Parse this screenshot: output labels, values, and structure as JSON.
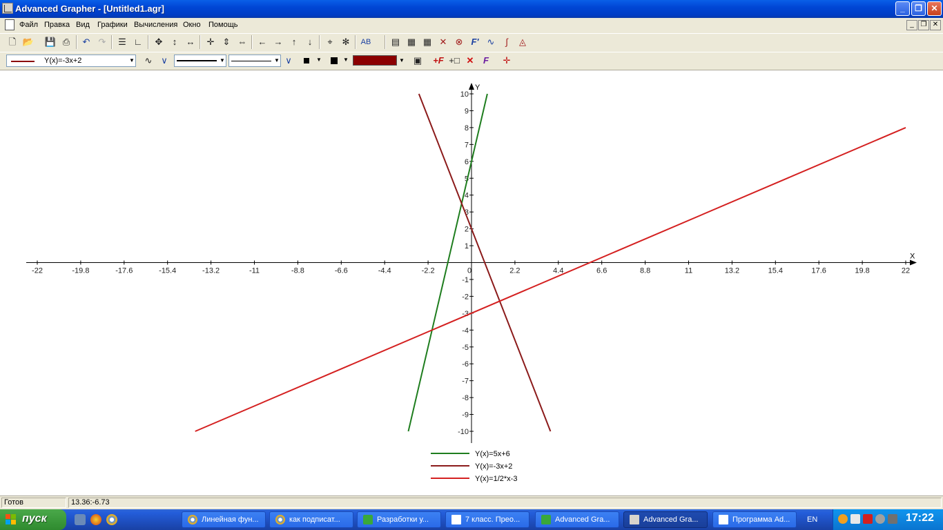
{
  "window": {
    "title": "Advanced Grapher - [Untitled1.agr]",
    "controls": {
      "minimize": "_",
      "maximize": "❐",
      "close": "✕"
    }
  },
  "menu": {
    "items": [
      "Файл",
      "Правка",
      "Вид",
      "Графики",
      "Вычисления",
      "Окно",
      "Помощь"
    ],
    "mdi": {
      "minimize": "_",
      "restore": "❐",
      "close": "✕"
    }
  },
  "toolbar2": {
    "function_select": "Y(x)=-3x+2",
    "color": "#8b0000"
  },
  "chart_data": {
    "type": "line",
    "x_axis_label": "X",
    "y_axis_label": "Y",
    "xlim": [
      -22,
      22
    ],
    "ylim": [
      -10,
      10
    ],
    "x_ticks": [
      "-22",
      "-19.8",
      "-17.6",
      "-15.4",
      "-13.2",
      "-11",
      "-8.8",
      "-6.6",
      "-4.4",
      "-2.2",
      "0",
      "2.2",
      "4.4",
      "6.6",
      "8.8",
      "11",
      "13.2",
      "15.4",
      "17.6",
      "19.8",
      "22"
    ],
    "y_ticks": [
      "10",
      "9",
      "8",
      "7",
      "6",
      "5",
      "4",
      "3",
      "2",
      "1",
      "-1",
      "-2",
      "-3",
      "-4",
      "-5",
      "-6",
      "-7",
      "-8",
      "-9",
      "-10"
    ],
    "series": [
      {
        "name": "Y(x)=5x+6",
        "color": "#1e7d1e",
        "x": [
          -3.2,
          0.8
        ],
        "y": [
          -10,
          10
        ]
      },
      {
        "name": "Y(x)=-3x+2",
        "color": "#8b1a1a",
        "x": [
          -2.6667,
          4
        ],
        "y": [
          10,
          -10
        ]
      },
      {
        "name": "Y(x)=1/2*x-3",
        "color": "#d42020",
        "x": [
          -14,
          22
        ],
        "y": [
          -10,
          8
        ]
      }
    ],
    "legend_position": "bottom-center"
  },
  "status": {
    "state": "Готов",
    "coords": "13.36:-6.73"
  },
  "taskbar": {
    "start_label": "пуск",
    "tasks": [
      {
        "label": "Линейная фун...",
        "icon_color": "#e8b020"
      },
      {
        "label": "как подписат...",
        "icon_color": "#e8b020"
      },
      {
        "label": "Разработки у...",
        "icon_color": "#3aa83a"
      },
      {
        "label": "7 класс. Прео...",
        "icon_color": "#ffffff"
      },
      {
        "label": "Advanced Gra...",
        "icon_color": "#3aa83a"
      },
      {
        "label": "Advanced Gra...",
        "icon_color": "#d8d4cc"
      },
      {
        "label": "Программа Ad...",
        "icon_color": "#ffffff"
      }
    ],
    "language": "EN",
    "clock": "17:22"
  }
}
